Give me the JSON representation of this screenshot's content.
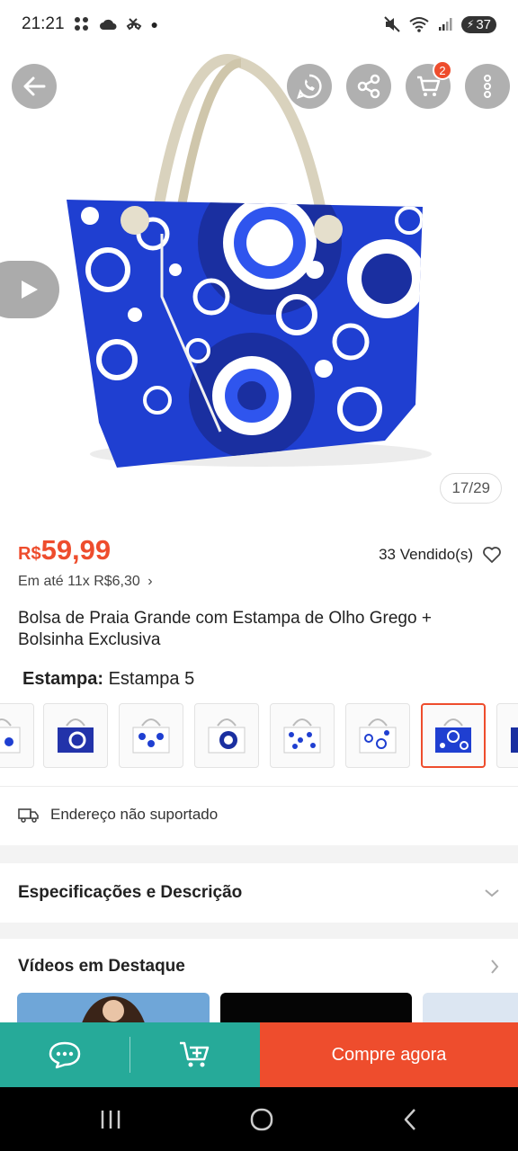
{
  "status_bar": {
    "time": "21:21",
    "battery": "37",
    "icons": [
      "grid-icon",
      "cloud-icon",
      "missed-call-icon",
      "dot-icon",
      "mute-icon",
      "wifi-icon",
      "signal-icon",
      "battery-icon"
    ]
  },
  "hero": {
    "image_counter": "17/29",
    "cart_count": "2",
    "buttons": [
      "back-icon",
      "whatsapp-icon",
      "share-icon",
      "cart-icon",
      "more-icon",
      "play-icon"
    ]
  },
  "product": {
    "currency": "R$",
    "price": "59,99",
    "sold": "33 Vendido(s)",
    "installments": "Em até 11x R$6,30",
    "title": "Bolsa de Praia Grande com Estampa de Olho Grego + Bolsinha Exclusiva",
    "variant_label": "Estampa:",
    "variant_value": "Estampa 5",
    "thumbnail_count": 8,
    "selected_thumbnail": 6
  },
  "shipping": {
    "address_text": "Endereço não suportado"
  },
  "sections": {
    "specs_title": "Especificações e Descrição",
    "videos_title": "Vídeos em Destaque"
  },
  "action_bar": {
    "buy_label": "Compre agora"
  },
  "colors": {
    "accent": "#ee4d2d",
    "teal": "#26aa99",
    "bag_blue": "#1f3fd1"
  }
}
